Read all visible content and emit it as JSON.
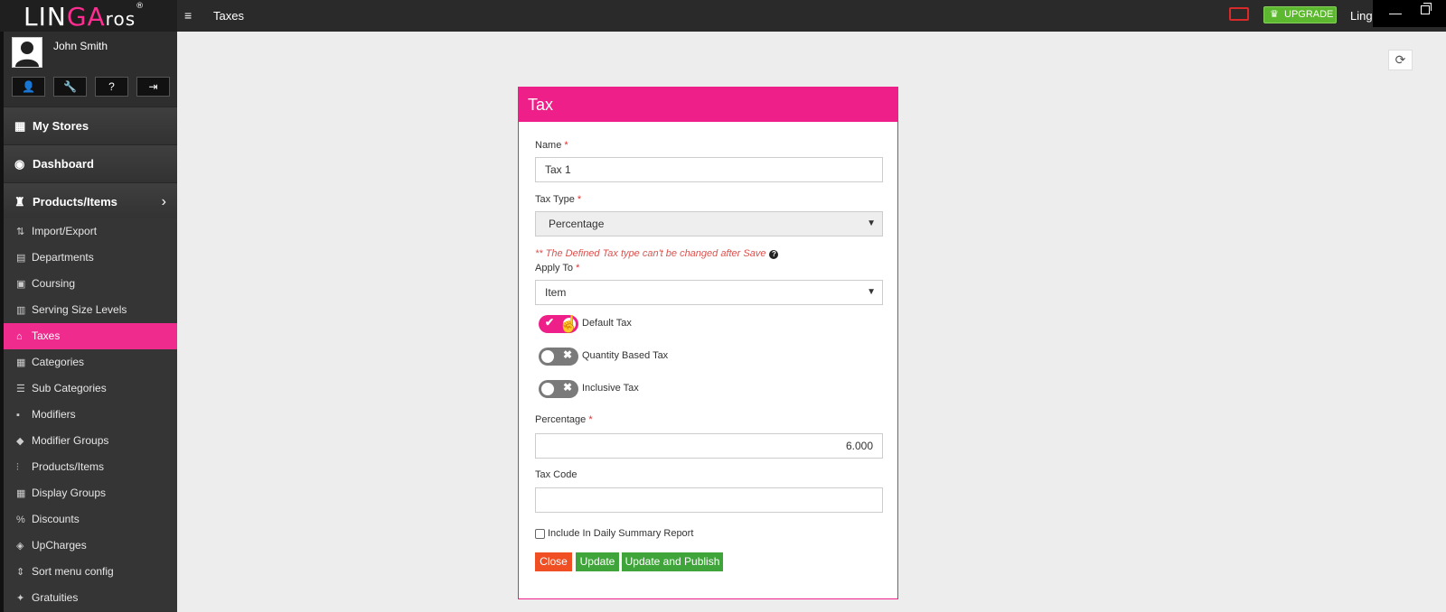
{
  "topbar": {
    "logo_main": "LIN",
    "logo_accent": "GA",
    "logo_suffix": "ros",
    "logo_reg": "®",
    "page_title": "Taxes",
    "upgrade_label": "UPGRADE",
    "user_label": "Linga",
    "upgrade_color": "#5cb82e",
    "alert_color": "#d92a2a"
  },
  "sidebar": {
    "user_name": "John Smith",
    "main_items": [
      {
        "label": "My Stores",
        "icon": "store-icon"
      },
      {
        "label": "Dashboard",
        "icon": "dashboard-icon"
      },
      {
        "label": "Products/Items",
        "icon": "basket-icon"
      }
    ],
    "sub_items": [
      {
        "label": "Import/Export",
        "icon": "import-export-icon"
      },
      {
        "label": "Departments",
        "icon": "departments-icon"
      },
      {
        "label": "Coursing",
        "icon": "coursing-icon"
      },
      {
        "label": "Serving Size Levels",
        "icon": "serving-size-icon"
      },
      {
        "label": "Taxes",
        "icon": "tax-icon"
      },
      {
        "label": "Categories",
        "icon": "categories-icon"
      },
      {
        "label": "Sub Categories",
        "icon": "sub-categories-icon"
      },
      {
        "label": "Modifiers",
        "icon": "modifiers-icon"
      },
      {
        "label": "Modifier Groups",
        "icon": "modifier-groups-icon"
      },
      {
        "label": "Products/Items",
        "icon": "products-icon"
      },
      {
        "label": "Display Groups",
        "icon": "display-groups-icon"
      },
      {
        "label": "Discounts",
        "icon": "discounts-icon"
      },
      {
        "label": "UpCharges",
        "icon": "tag-icon"
      },
      {
        "label": "Sort menu config",
        "icon": "sort-icon"
      },
      {
        "label": "Gratuities",
        "icon": "gratuities-icon"
      }
    ],
    "active_item": "Taxes",
    "active_color": "#ef2c8d"
  },
  "modal": {
    "title": "Tax",
    "header_color": "#ef1f8a",
    "name_label": "Name",
    "name_value": "Tax 1",
    "tax_type_label": "Tax Type",
    "tax_type_value": "Percentage",
    "warning": "** The Defined Tax type can't be changed after Save",
    "apply_to_label": "Apply To",
    "apply_to_value": "Item",
    "required_mark": "*",
    "toggles": [
      {
        "label": "Default Tax",
        "on": true
      },
      {
        "label": "Quantity Based Tax",
        "on": false
      },
      {
        "label": "Inclusive Tax",
        "on": false
      }
    ],
    "percentage_label": "Percentage",
    "percentage_value": "6.000",
    "tax_code_label": "Tax Code",
    "tax_code_value": "",
    "daily_summary_label": "Include In Daily Summary Report",
    "daily_summary_checked": false,
    "close_label": "Close",
    "update_label": "Update",
    "publish_label": "Update and Publish"
  }
}
